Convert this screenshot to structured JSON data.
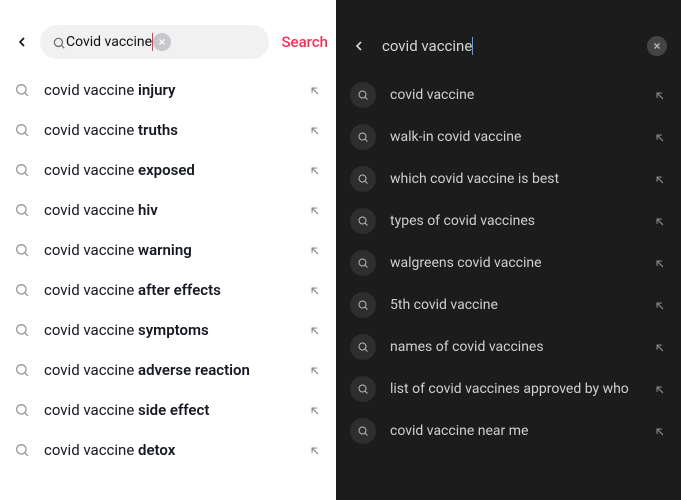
{
  "light": {
    "query": "Covid vaccine",
    "search_label": "Search",
    "suggestions": [
      {
        "prefix": "covid vaccine ",
        "bold": "injury"
      },
      {
        "prefix": "covid vaccine ",
        "bold": "truths"
      },
      {
        "prefix": "covid vaccine ",
        "bold": "exposed"
      },
      {
        "prefix": "covid vaccine ",
        "bold": "hiv"
      },
      {
        "prefix": "covid vaccine ",
        "bold": "warning"
      },
      {
        "prefix": "covid vaccine ",
        "bold": "after effects"
      },
      {
        "prefix": "covid vaccine ",
        "bold": "symptoms"
      },
      {
        "prefix": "covid vaccine ",
        "bold": "adverse reaction"
      },
      {
        "prefix": "covid vaccine ",
        "bold": "side effect"
      },
      {
        "prefix": "covid vaccine ",
        "bold": "detox"
      }
    ]
  },
  "dark": {
    "query": "covid vaccine",
    "suggestions": [
      "covid vaccine",
      "walk-in covid vaccine",
      "which covid vaccine is best",
      "types of covid vaccines",
      "walgreens covid vaccine",
      "5th covid vaccine",
      "names of covid vaccines",
      "list of covid vaccines approved by who",
      "covid vaccine near me"
    ]
  }
}
